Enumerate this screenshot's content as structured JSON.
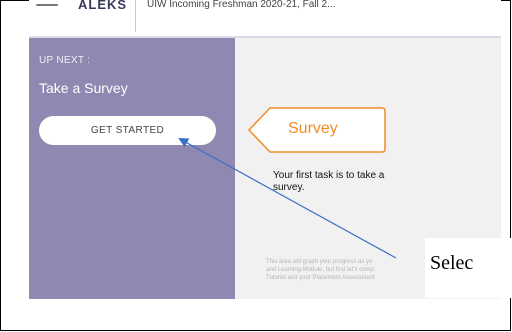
{
  "header": {
    "brand": "ALEKS",
    "course": "UIW Incoming Freshman 2020-21, Fall 2..."
  },
  "sidebar": {
    "up_next_label": "UP NEXT :",
    "next_title": "Take a Survey",
    "start_button": "GET STARTED"
  },
  "main": {
    "callout_label": "Survey",
    "task_text": "Your first task is to take a survey.",
    "progress_lines": [
      "This area will graph your progress as yo",
      "and Learning Module, but first let's comp",
      "Tutorial and your Placement Assessment"
    ]
  },
  "annotation": {
    "label": "Selec",
    "arrow_color": "#3b6fc4"
  },
  "colors": {
    "sidebar_bg": "#8f88b0",
    "callout_orange": "#f28c28"
  }
}
